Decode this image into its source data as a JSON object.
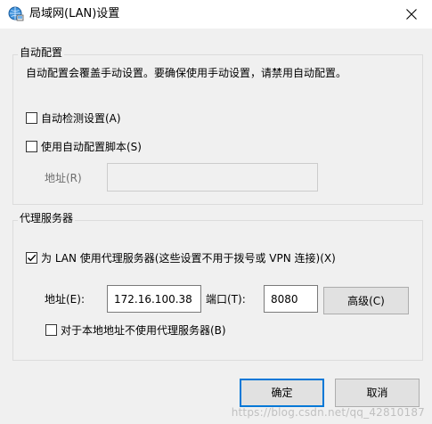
{
  "window": {
    "title": "局域网(LAN)设置",
    "close_icon": "close-icon",
    "app_icon": "network-settings-icon"
  },
  "auto_config": {
    "group_label": "自动配置",
    "description": "自动配置会覆盖手动设置。要确保使用手动设置，请禁用自动配置。",
    "detect_settings": {
      "label": "自动检测设置(A)",
      "checked": false
    },
    "use_script": {
      "label": "使用自动配置脚本(S)",
      "checked": false
    },
    "address_label": "地址(R)",
    "address_value": ""
  },
  "proxy": {
    "group_label": "代理服务器",
    "use_proxy": {
      "label": "为 LAN 使用代理服务器(这些设置不用于拨号或 VPN 连接)(X)",
      "checked": true
    },
    "address_label": "地址(E):",
    "address_value": "172.16.100.38",
    "port_label": "端口(T):",
    "port_value": "8080",
    "advanced_button": "高级(C)",
    "bypass_local": {
      "label": "对于本地地址不使用代理服务器(B)",
      "checked": false
    }
  },
  "footer": {
    "ok_button": "确定",
    "cancel_button": "取消"
  },
  "watermark": "https://blog.csdn.net/qq_42810187",
  "colors": {
    "dialog_bg": "#f0f0f0",
    "titlebar_bg": "#ffffff",
    "accent": "#0078d7",
    "button_bg": "#e1e1e1"
  }
}
